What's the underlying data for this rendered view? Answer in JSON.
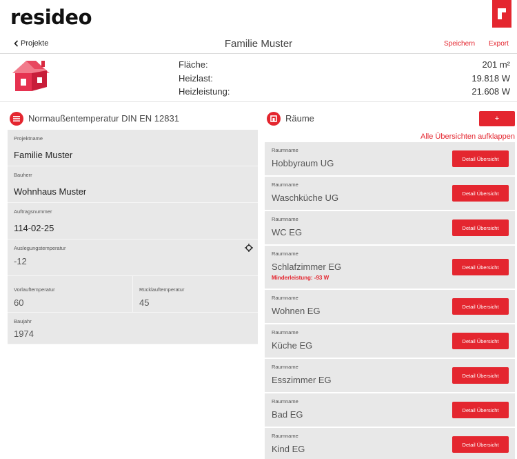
{
  "header": {
    "logo": "resideo",
    "back_label": "Projekte",
    "title": "Familie Muster",
    "save_label": "Speichern",
    "export_label": "Export"
  },
  "summary": {
    "area_label": "Fläche:",
    "area_value": "201 m²",
    "load_label": "Heizlast:",
    "load_value": "19.818 W",
    "power_label": "Heizleistung:",
    "power_value": "21.608 W"
  },
  "left_section": {
    "title": "Normaußentemperatur DIN EN 12831",
    "fields": [
      {
        "label": "Projektname",
        "value": "Familie Muster"
      },
      {
        "label": "Bauherr",
        "value": "Wohnhaus Muster"
      },
      {
        "label": "Auftragsnummer",
        "value": "114-02-25"
      },
      {
        "label": "Auslegungstemperatur",
        "value": "-12"
      },
      {
        "label": "Vorlauftemperatur",
        "value": "60"
      },
      {
        "label": "Rücklauftemperatur",
        "value": "45"
      },
      {
        "label": "Baujahr",
        "value": "1974"
      }
    ]
  },
  "right_section": {
    "title": "Räume",
    "add_label": "+",
    "expand_label": "Alle Übersichten aufklappen",
    "room_label": "Raumname",
    "detail_label": "Detail Übersicht",
    "rooms": [
      {
        "name": "Hobbyraum UG"
      },
      {
        "name": "Waschküche UG"
      },
      {
        "name": "WC EG"
      },
      {
        "name": "Schlafzimmer EG",
        "warning": "Minderleistung: -93 W"
      },
      {
        "name": "Wohnen EG"
      },
      {
        "name": "Küche EG"
      },
      {
        "name": "Esszimmer EG"
      },
      {
        "name": "Bad EG"
      },
      {
        "name": "Kind EG"
      }
    ]
  },
  "colors": {
    "accent": "#e4262f",
    "panel": "#e8e8e8"
  },
  "icons": [
    "chevron-left-icon",
    "house-icon",
    "list-icon",
    "room-icon",
    "crosshair-icon"
  ]
}
